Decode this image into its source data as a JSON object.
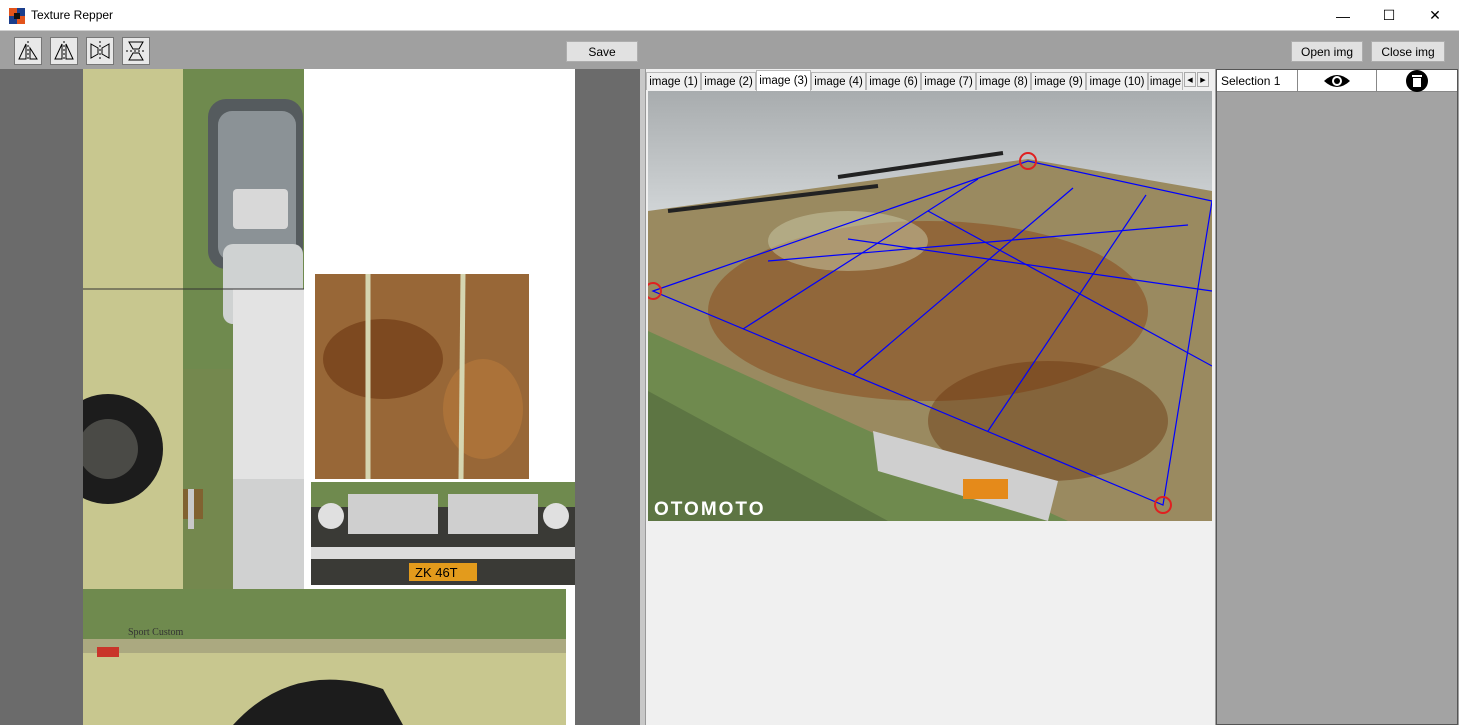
{
  "window": {
    "title": "Texture Repper",
    "minimize": "—",
    "maximize": "☐",
    "close": "✕"
  },
  "toolbar": {
    "tools": [
      {
        "name": "flip-diagonal-icon"
      },
      {
        "name": "rotate-mirror-icon"
      },
      {
        "name": "mirror-horizontal-icon"
      },
      {
        "name": "mirror-vertical-icon"
      }
    ],
    "save_label": "Save",
    "open_label": "Open img",
    "close_label": "Close img"
  },
  "tabs": [
    "image (1)",
    "image (2)",
    "image (3)",
    "image (4)",
    "image (6)",
    "image (7)",
    "image (8)",
    "image (9)",
    "image (10)",
    "image"
  ],
  "active_tab": 2,
  "photo": {
    "watermark": "OTOMOTO"
  },
  "atlas": {
    "plate": "ZK 46T",
    "emblem": "Sport Custom"
  },
  "selections": [
    {
      "label": "Selection 1",
      "visible_icon": "eye-icon",
      "delete_icon": "trash-icon"
    }
  ],
  "colors": {
    "quad_grid": "#0000ff",
    "handle": "#e02020",
    "truck_green": "#6f8a4e",
    "rust": "#8a4a1c"
  }
}
